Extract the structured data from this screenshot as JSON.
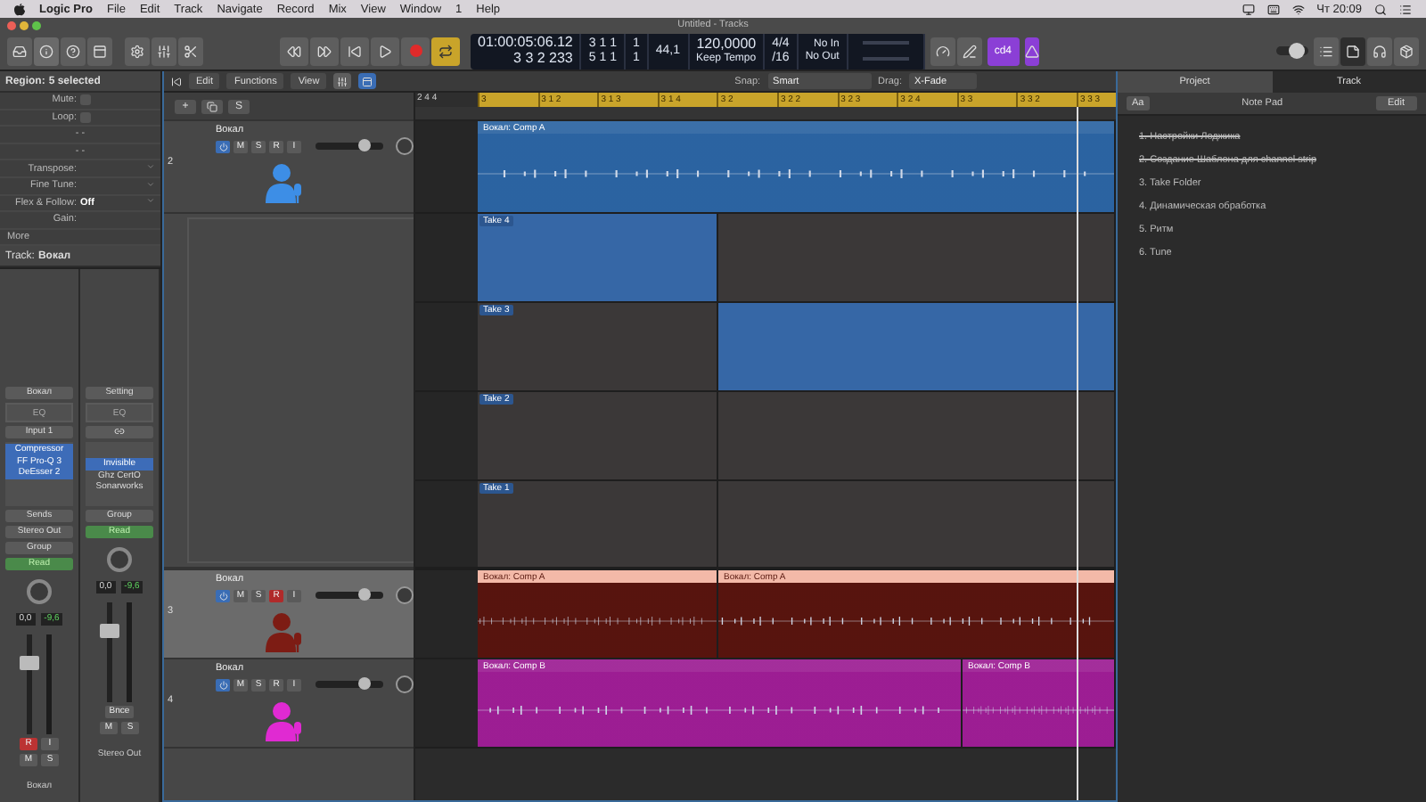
{
  "menu_bar": {
    "app": "Logic Pro",
    "items": [
      "File",
      "Edit",
      "Track",
      "Navigate",
      "Record",
      "Mix",
      "View",
      "Window",
      "1",
      "Help"
    ],
    "clock": "Чт 20:09"
  },
  "window": {
    "title": "Untitled - Tracks"
  },
  "transport": {
    "cycle": true
  },
  "lcd": {
    "time": "01:00:05:06.12",
    "bars": "3 3 2 233",
    "left_locator": "3 1 1",
    "left_locator_sub": "1",
    "right_locator": "5 1 1",
    "right_locator_sub": "1",
    "sample_rate": "44,1",
    "tempo": "120,0000",
    "tempo_mode": "Keep Tempo",
    "signature": "4/4",
    "division": "/16",
    "input": "No In",
    "output": "No Out"
  },
  "count_in": {
    "label": "cd4"
  },
  "master_volume": {
    "level": 0.6
  },
  "view_buttons": [
    {
      "selected": false
    },
    {
      "selected": true
    },
    {
      "selected": false
    },
    {
      "selected": false
    }
  ],
  "inspector": {
    "title": "Region:",
    "selection": "5 selected",
    "rows": [
      {
        "kind": "checkbox",
        "label": "Mute:",
        "checked": false
      },
      {
        "kind": "checkbox",
        "label": "Loop:",
        "checked": false
      },
      {
        "kind": "dashes",
        "value": "- -"
      },
      {
        "kind": "dashes",
        "value": "- -"
      },
      {
        "kind": "stepper",
        "label": "Transpose:"
      },
      {
        "kind": "stepper",
        "label": "Fine Tune:"
      },
      {
        "kind": "stepper",
        "label": "Flex & Follow:",
        "value": "Off"
      },
      {
        "kind": "plain",
        "label": "Gain:"
      }
    ],
    "more": "More",
    "track_label": "Track:",
    "track_name": "Вокал"
  },
  "channel_strips": [
    {
      "kind": "track",
      "setting": "Вокал",
      "eq": "EQ",
      "input": "Input 1",
      "plugins": [
        {
          "name": "Compressor",
          "selected": true
        },
        {
          "name": "FF Pro-Q 3",
          "selected": true
        },
        {
          "name": "DeEsser 2",
          "selected": true
        }
      ],
      "sends": "Sends",
      "output": "Stereo Out",
      "group": "Group",
      "automation": "Read",
      "pan_value": "0,0",
      "peak": "-9,6",
      "fader": {
        "level": 0.72
      },
      "record_armed": true,
      "record": "R",
      "input_monitor": "I",
      "mute": "M",
      "solo": "S",
      "name": "Вокал"
    },
    {
      "kind": "output",
      "setting": "Setting",
      "eq": "EQ",
      "plugins": [
        {
          "name": "Invisible",
          "selected": true
        },
        {
          "name": "Ghz CertO",
          "selected": false
        },
        {
          "name": "Sonarworks",
          "selected": false
        }
      ],
      "group": "Group",
      "automation": "Read",
      "pan_value": "0,0",
      "peak": "-9,6",
      "fader": {
        "level": 0.72
      },
      "bounce": "Bnce",
      "mute": "M",
      "solo": "S",
      "name": "Stereo Out"
    }
  ],
  "tracks_toolbar": {
    "menus": [
      "Edit",
      "Functions",
      "View"
    ],
    "snap_label": "Snap:",
    "snap": "Smart",
    "drag_label": "Drag:",
    "drag": "X-Fade",
    "add": "+",
    "solo": "S"
  },
  "ruler": {
    "start": "2 4 4",
    "marks": [
      "3",
      "3 1 2",
      "3 1 3",
      "3 1 4",
      "3 2",
      "3 2 2",
      "3 2 3",
      "3 2 4",
      "3 3",
      "3 3 2",
      "3 3 3"
    ]
  },
  "tracks": [
    {
      "number": "2",
      "name": "Вокал",
      "color": "#3d8ee6",
      "selected": false,
      "record_armed": false,
      "buttons": [
        "M",
        "S",
        "R",
        "I"
      ],
      "volume": {
        "level": 0.72
      },
      "regions": [
        {
          "label": "Вокал: Comp A"
        }
      ],
      "takes": [
        {
          "label": "Take 4",
          "segments": [
            {
              "active": true
            },
            {
              "active": false
            }
          ]
        },
        {
          "label": "Take 3",
          "segments": [
            {
              "active": false
            },
            {
              "active": true
            }
          ]
        },
        {
          "label": "Take 2",
          "segments": [
            {
              "active": false
            },
            {
              "active": false
            }
          ]
        },
        {
          "label": "Take 1",
          "segments": [
            {
              "active": false
            },
            {
              "active": false
            }
          ]
        }
      ]
    },
    {
      "number": "3",
      "name": "Вокал",
      "color": "#7d1c14",
      "selected": true,
      "record_armed": true,
      "buttons": [
        "M",
        "S",
        "R",
        "I"
      ],
      "volume": {
        "level": 0.72
      },
      "regions": [
        {
          "label": "Вокал: Comp A"
        },
        {
          "label": "Вокал: Comp A"
        }
      ]
    },
    {
      "number": "4",
      "name": "Вокал",
      "color": "#e02ad2",
      "selected": false,
      "record_armed": false,
      "buttons": [
        "M",
        "S",
        "R",
        "I"
      ],
      "volume": {
        "level": 0.72
      },
      "regions": [
        {
          "label": "Вокал: Comp B"
        },
        {
          "label": "Вокал: Comp B"
        }
      ]
    }
  ],
  "note_pad": {
    "tabs": [
      {
        "label": "Project",
        "selected": false
      },
      {
        "label": "Track",
        "selected": true
      }
    ],
    "font_button": "Aa",
    "title": "Note Pad",
    "edit": "Edit",
    "items": [
      {
        "text": "1. Настройки Лоджика",
        "done": true
      },
      {
        "text": "2. Создание Шаблона для channel strip",
        "done": true
      },
      {
        "text": "3. Take Folder",
        "done": false
      },
      {
        "text": "4. Динамическая обработка",
        "done": false
      },
      {
        "text": "5. Ритм",
        "done": false
      },
      {
        "text": "6. Tune",
        "done": false
      }
    ]
  }
}
